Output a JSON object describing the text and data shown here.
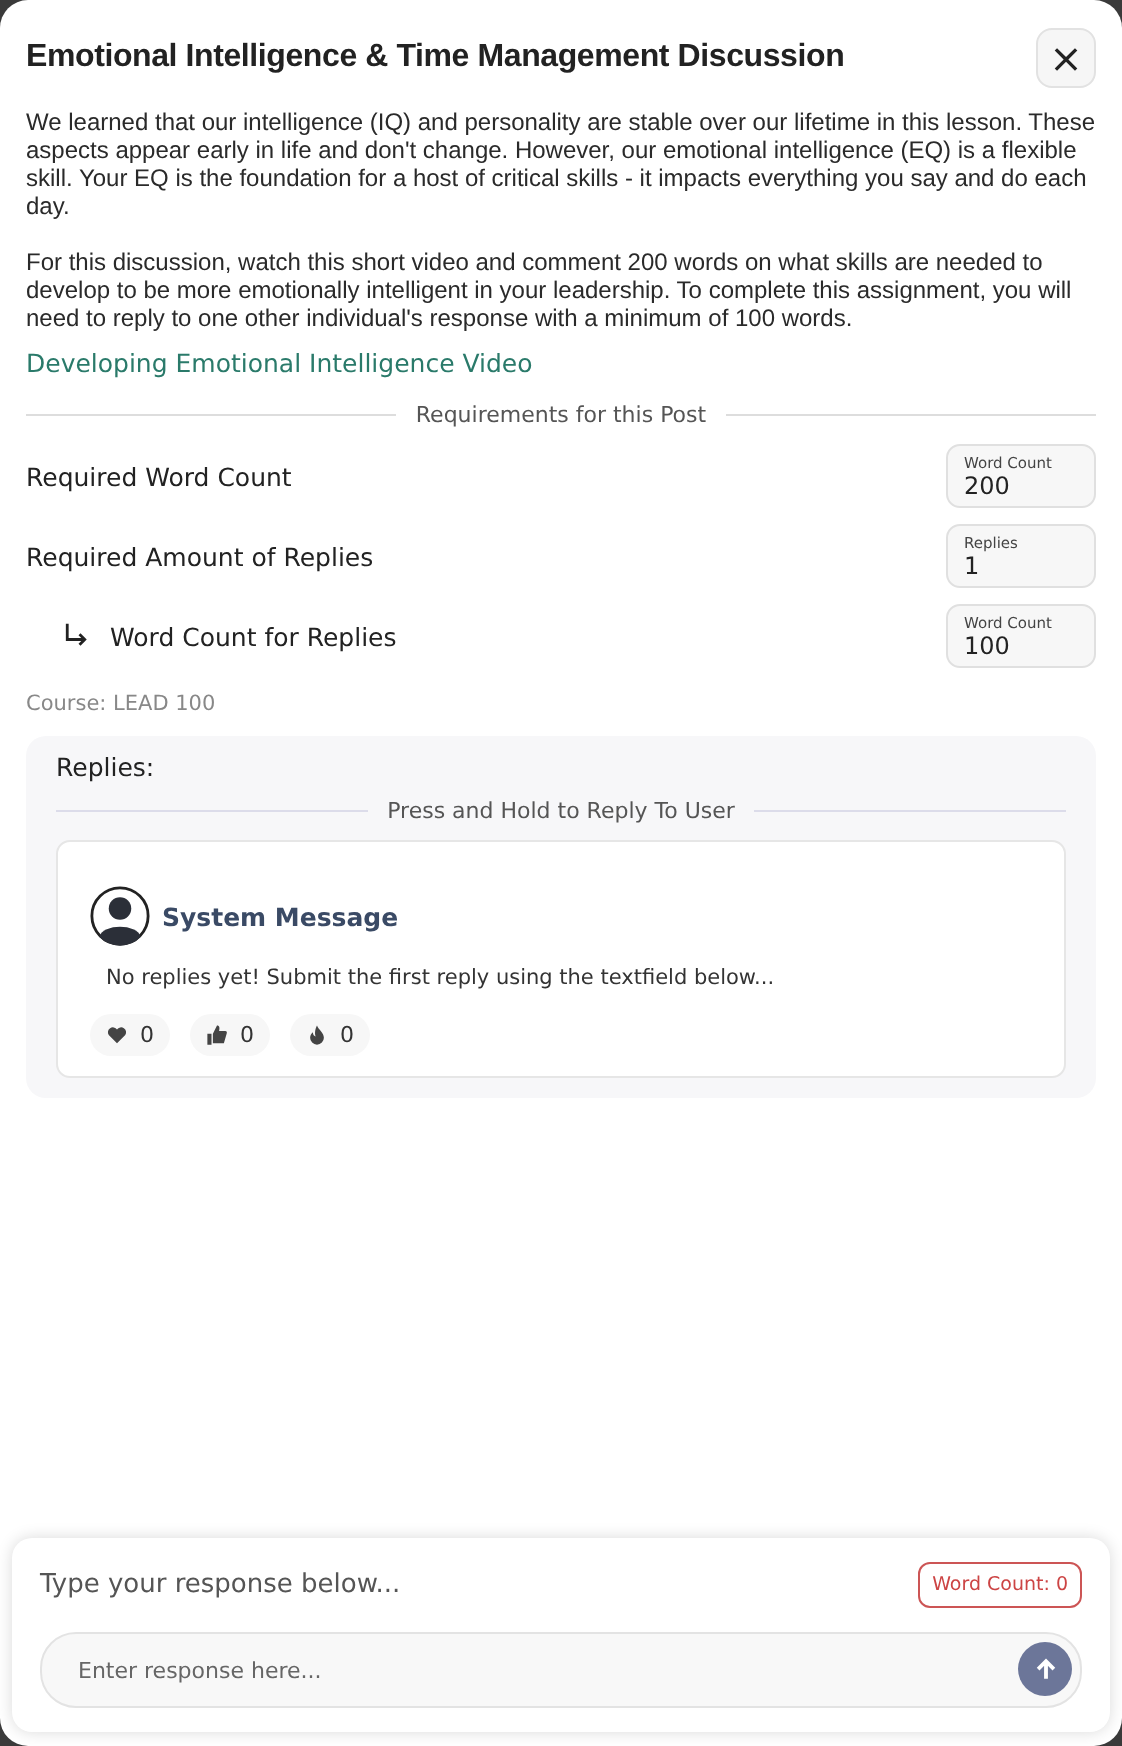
{
  "dialog": {
    "title": "Emotional Intelligence & Time Management Discussion",
    "close_label": "×"
  },
  "description": [
    "We learned that our intelligence (IQ) and personality are stable over our lifetime in this lesson. These aspects appear early in life and don't change. However, our emotional intelligence (EQ) is a flexible skill. Your EQ is the foundation for a host of critical skills - it impacts everything you say and do each day.",
    "For this discussion, watch this short video and comment 200 words on what skills are needed to develop to be more emotionally intelligent in your leadership. To complete this assignment, you will need to reply to one other individual's response with a minimum of 100 words."
  ],
  "video_link": "Developing Emotional Intelligence Video",
  "requirements": {
    "heading": "Requirements for this Post",
    "items": [
      {
        "label": "Required Word Count",
        "field_label": "Word Count",
        "value": "200",
        "sub": false
      },
      {
        "label": "Required Amount of Replies",
        "field_label": "Replies",
        "value": "1",
        "sub": false
      },
      {
        "label": "Word Count for Replies",
        "field_label": "Word Count",
        "value": "100",
        "sub": true
      }
    ]
  },
  "course": "Course: LEAD 100",
  "replies": {
    "heading": "Replies:",
    "divider": "Press and Hold to Reply To User",
    "messages": [
      {
        "author": "System Message",
        "text": "No replies yet! Submit the first reply using the textfield below...",
        "reactions": [
          {
            "kind": "heart",
            "count": "0"
          },
          {
            "kind": "thumb",
            "count": "0"
          },
          {
            "kind": "fire",
            "count": "0"
          }
        ]
      }
    ]
  },
  "composer": {
    "prompt": "Type your response below...",
    "word_count": "Word Count: 0",
    "placeholder": "Enter response here..."
  }
}
